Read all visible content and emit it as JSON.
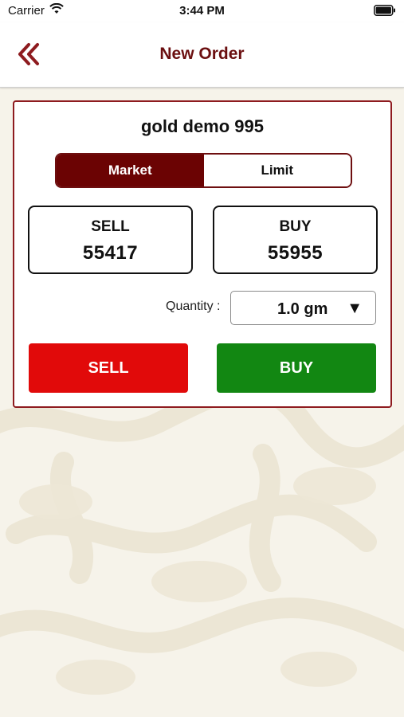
{
  "status_bar": {
    "carrier": "Carrier",
    "time": "3:44 PM"
  },
  "nav": {
    "title": "New Order",
    "back_icon": "double-chevron-left-icon"
  },
  "order": {
    "product_name": "gold demo 995",
    "order_types": [
      {
        "label": "Market",
        "selected": true
      },
      {
        "label": "Limit",
        "selected": false
      }
    ],
    "sell_price": {
      "label": "SELL",
      "value": "55417"
    },
    "buy_price": {
      "label": "BUY",
      "value": "55955"
    },
    "quantity": {
      "label": "Quantity :",
      "value": "1.0 gm"
    },
    "sell_button": "SELL",
    "buy_button": "BUY"
  },
  "colors": {
    "brand": "#6b0f10",
    "sell": "#e10a0a",
    "buy": "#128712",
    "background": "#f6f3ea"
  }
}
